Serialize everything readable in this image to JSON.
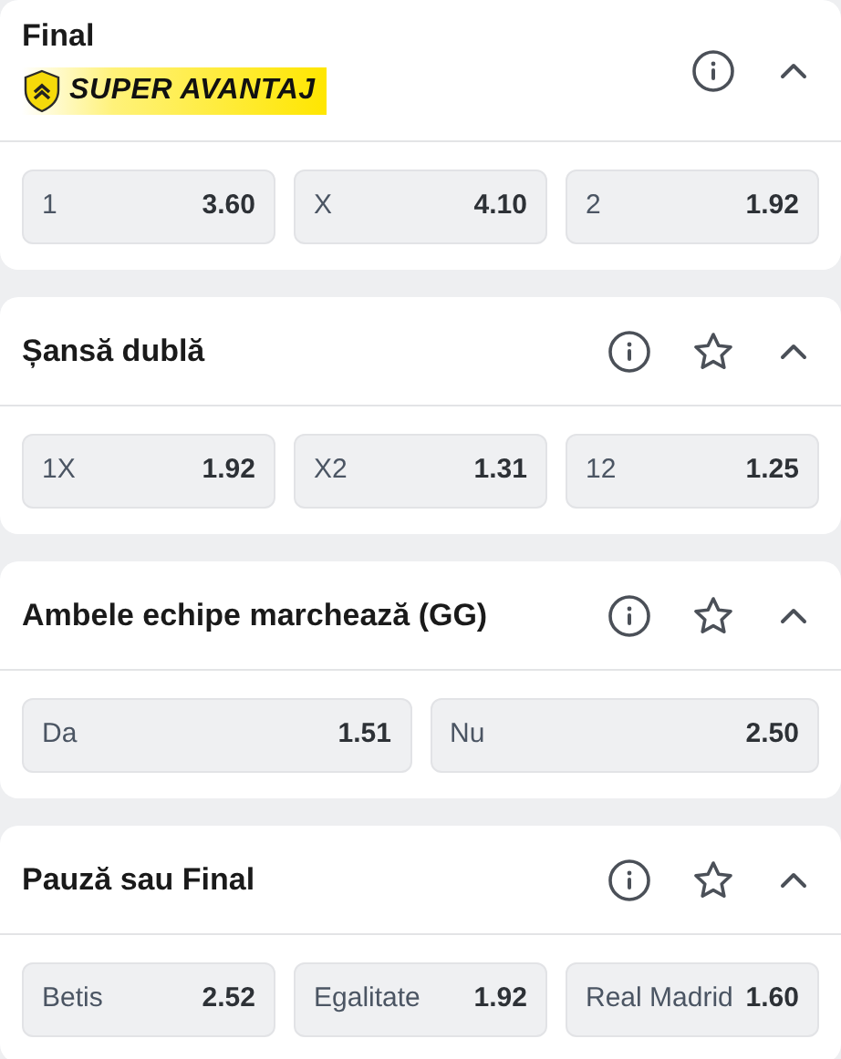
{
  "markets": [
    {
      "title": "Final",
      "badge": "SUPER AVANTAJ",
      "show_favorite": false,
      "expanded": true,
      "odds": [
        {
          "label": "1",
          "value": "3.60"
        },
        {
          "label": "X",
          "value": "4.10"
        },
        {
          "label": "2",
          "value": "1.92"
        }
      ]
    },
    {
      "title": "Șansă dublă",
      "show_favorite": true,
      "expanded": true,
      "odds": [
        {
          "label": "1X",
          "value": "1.92"
        },
        {
          "label": "X2",
          "value": "1.31"
        },
        {
          "label": "12",
          "value": "1.25"
        }
      ]
    },
    {
      "title": "Ambele echipe marchează (GG)",
      "show_favorite": true,
      "expanded": true,
      "odds": [
        {
          "label": "Da",
          "value": "1.51"
        },
        {
          "label": "Nu",
          "value": "2.50"
        }
      ]
    },
    {
      "title": "Pauză sau Final",
      "show_favorite": true,
      "expanded": true,
      "odds": [
        {
          "label": "Betis",
          "value": "2.52"
        },
        {
          "label": "Egalitate",
          "value": "1.92"
        },
        {
          "label": "Real Madrid",
          "value": "1.60"
        }
      ]
    }
  ]
}
